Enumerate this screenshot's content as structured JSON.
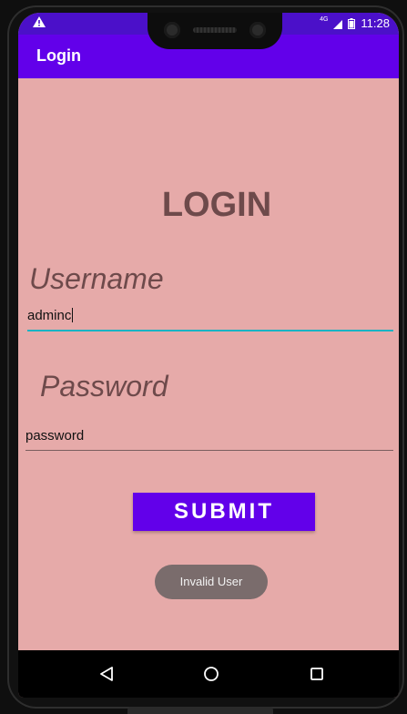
{
  "status_bar": {
    "network_label": "4G",
    "time": "11:28",
    "warning_icon": "warning-triangle-icon",
    "signal_icon": "signal-icon",
    "battery_icon": "battery-icon"
  },
  "app_bar": {
    "title": "Login"
  },
  "form": {
    "heading": "LOGIN",
    "username_label": "Username",
    "username_value": "adminc",
    "password_label": "Password",
    "password_value": "password",
    "submit_label": "SUBMIT"
  },
  "toast": {
    "message": "Invalid User"
  },
  "nav_bar": {
    "back_icon": "back-triangle-icon",
    "home_icon": "home-circle-icon",
    "recents_icon": "recents-square-icon"
  },
  "colors": {
    "app_bar": "#6200ea",
    "status_bar": "#4b10c9",
    "background": "#e6aaa9",
    "button": "#6200ea",
    "text_dark": "#6e4a4b",
    "accent_underline": "#1ab3c4",
    "toast_bg": "#7a6c6c"
  }
}
